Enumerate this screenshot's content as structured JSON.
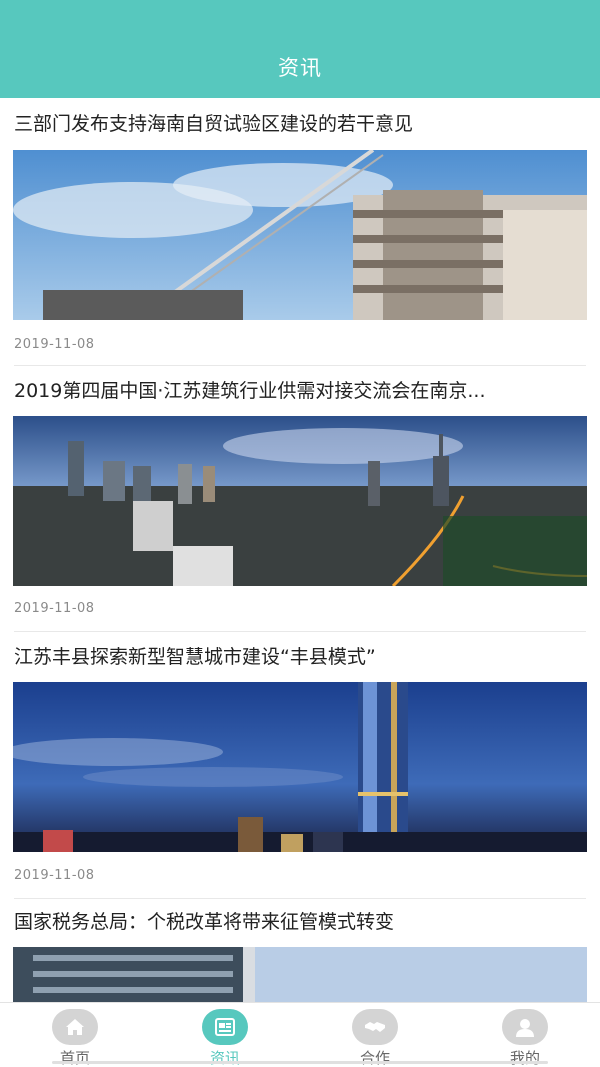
{
  "header": {
    "title": "资讯"
  },
  "articles": [
    {
      "title": "三部门发布支持海南自贸试验区建设的若干意见",
      "date": "2019-11-08",
      "image": "construction-crane-building"
    },
    {
      "title": "2019第四届中国·江苏建筑行业供需对接交流会在南京...",
      "date": "2019-11-08",
      "image": "city-skyline-dusk"
    },
    {
      "title": "江苏丰县探索新型智慧城市建设“丰县模式”",
      "date": "2019-11-08",
      "image": "tower-night-sky"
    },
    {
      "title": "国家税务总局：个税改革将带来征管模式转变",
      "date": "",
      "image": "office-building-sky"
    }
  ],
  "tabbar": {
    "tabs": [
      {
        "label": "首页",
        "icon": "home-icon",
        "active": false
      },
      {
        "label": "资讯",
        "icon": "news-icon",
        "active": true
      },
      {
        "label": "合作",
        "icon": "handshake-icon",
        "active": false
      },
      {
        "label": "我的",
        "icon": "user-icon",
        "active": false
      }
    ]
  },
  "colors": {
    "accent": "#57c8be",
    "inactive": "#d4d4d4"
  }
}
